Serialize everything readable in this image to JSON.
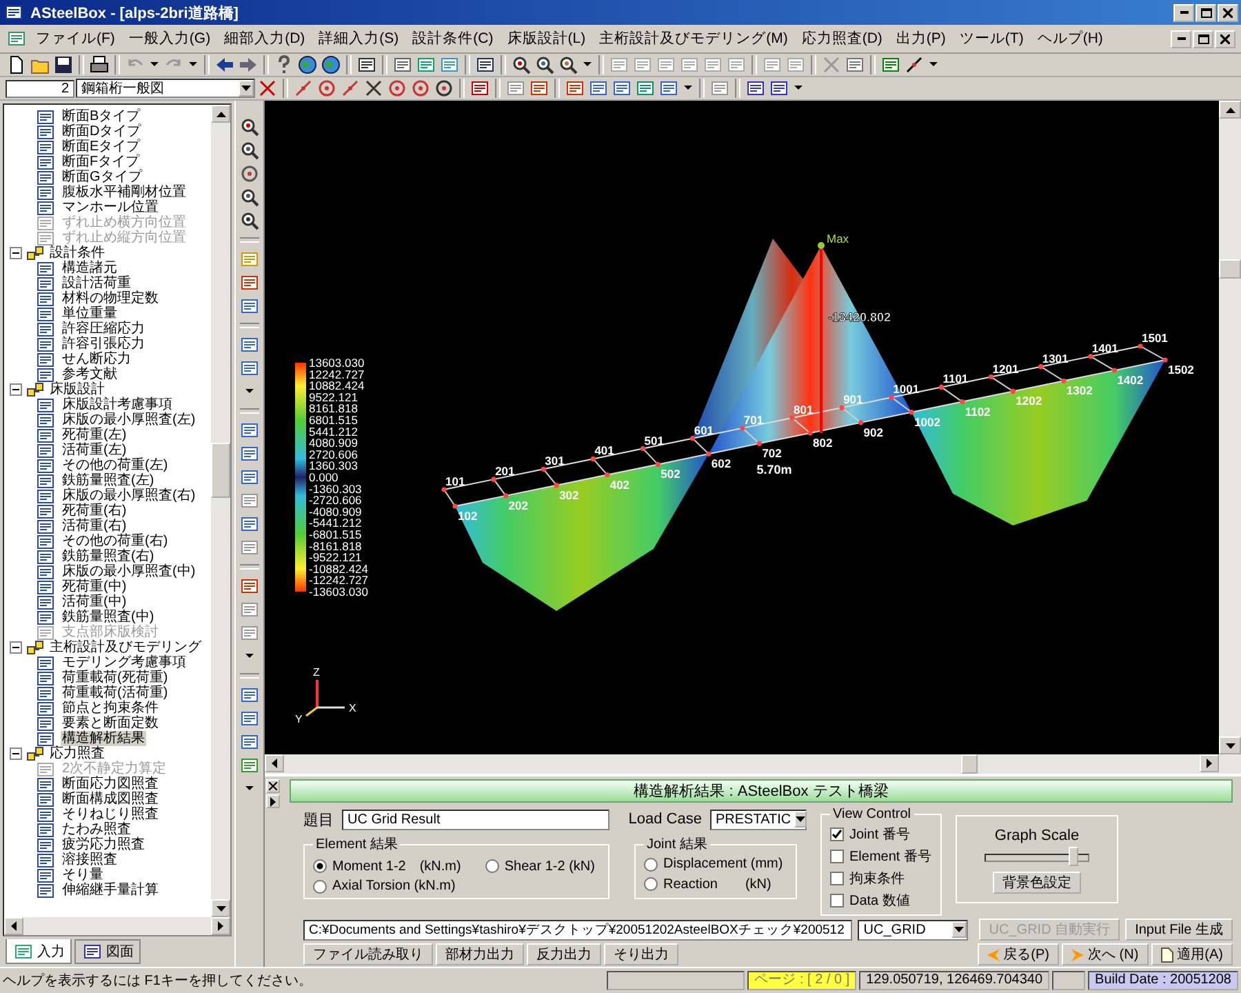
{
  "window": {
    "title": "ASteelBox - [alps-2bri道路橋]"
  },
  "menu": [
    "ファイル(F)",
    "一般入力(G)",
    "細部入力(D)",
    "詳細入力(S)",
    "設計条件(C)",
    "床版設計(L)",
    "主桁設計及びモデリング(M)",
    "応力照査(D)",
    "出力(P)",
    "ツール(T)",
    "ヘルプ(H)"
  ],
  "toolbar": {
    "page_number": "2",
    "view_select": "鋼箱桁一般図"
  },
  "tree": {
    "items": [
      {
        "label": "断面Bタイプ",
        "selected": false,
        "disabled": false
      },
      {
        "label": "断面Dタイプ",
        "selected": false,
        "disabled": false
      },
      {
        "label": "断面Eタイプ",
        "selected": false,
        "disabled": false
      },
      {
        "label": "断面Fタイプ",
        "selected": false,
        "disabled": false
      },
      {
        "label": "断面Gタイプ",
        "selected": false,
        "disabled": false
      },
      {
        "label": "腹板水平補剛材位置",
        "selected": false,
        "disabled": false
      },
      {
        "label": "マンホール位置",
        "selected": false,
        "disabled": false
      },
      {
        "label": "ずれ止め横方向位置",
        "selected": false,
        "disabled": true
      },
      {
        "label": "ずれ止め縦方向位置",
        "selected": false,
        "disabled": true
      }
    ],
    "groups": [
      {
        "label": "設計条件",
        "expanded": true,
        "children": [
          {
            "label": "構造諸元",
            "selected": false,
            "disabled": false
          },
          {
            "label": "設計活荷重",
            "selected": false,
            "disabled": false
          },
          {
            "label": "材料の物理定数",
            "selected": false,
            "disabled": false
          },
          {
            "label": "単位重量",
            "selected": false,
            "disabled": false
          },
          {
            "label": "許容圧縮応力",
            "selected": false,
            "disabled": false
          },
          {
            "label": "許容引張応力",
            "selected": false,
            "disabled": false
          },
          {
            "label": "せん断応力",
            "selected": false,
            "disabled": false
          },
          {
            "label": "参考文献",
            "selected": false,
            "disabled": false
          }
        ]
      },
      {
        "label": "床版設計",
        "expanded": true,
        "children": [
          {
            "label": "床版設計考慮事項",
            "selected": false,
            "disabled": false
          },
          {
            "label": "床版の最小厚照査(左)",
            "selected": false,
            "disabled": false
          },
          {
            "label": "死荷重(左)",
            "selected": false,
            "disabled": false
          },
          {
            "label": "活荷重(左)",
            "selected": false,
            "disabled": false
          },
          {
            "label": "その他の荷重(左)",
            "selected": false,
            "disabled": false
          },
          {
            "label": "鉄筋量照査(左)",
            "selected": false,
            "disabled": false
          },
          {
            "label": "床版の最小厚照査(右)",
            "selected": false,
            "disabled": false
          },
          {
            "label": "死荷重(右)",
            "selected": false,
            "disabled": false
          },
          {
            "label": "活荷重(右)",
            "selected": false,
            "disabled": false
          },
          {
            "label": "その他の荷重(右)",
            "selected": false,
            "disabled": false
          },
          {
            "label": "鉄筋量照査(右)",
            "selected": false,
            "disabled": false
          },
          {
            "label": "床版の最小厚照査(中)",
            "selected": false,
            "disabled": false
          },
          {
            "label": "死荷重(中)",
            "selected": false,
            "disabled": false
          },
          {
            "label": "活荷重(中)",
            "selected": false,
            "disabled": false
          },
          {
            "label": "鉄筋量照査(中)",
            "selected": false,
            "disabled": false
          },
          {
            "label": "支点部床版検討",
            "selected": false,
            "disabled": true
          }
        ]
      },
      {
        "label": "主桁設計及びモデリング",
        "expanded": true,
        "children": [
          {
            "label": "モデリング考慮事項",
            "selected": false,
            "disabled": false
          },
          {
            "label": "荷重載荷(死荷重)",
            "selected": false,
            "disabled": false
          },
          {
            "label": "荷重載荷(活荷重)",
            "selected": false,
            "disabled": false
          },
          {
            "label": "節点と拘束条件",
            "selected": false,
            "disabled": false
          },
          {
            "label": "要素と断面定数",
            "selected": false,
            "disabled": false
          },
          {
            "label": "構造解析結果",
            "selected": true,
            "disabled": false
          }
        ]
      },
      {
        "label": "応力照査",
        "expanded": true,
        "children": [
          {
            "label": "2次不静定力算定",
            "selected": false,
            "disabled": true
          },
          {
            "label": "断面応力図照査",
            "selected": false,
            "disabled": false
          },
          {
            "label": "断面構成図照査",
            "selected": false,
            "disabled": false
          },
          {
            "label": "そりねじり照査",
            "selected": false,
            "disabled": false
          },
          {
            "label": "たわみ照査",
            "selected": false,
            "disabled": false
          },
          {
            "label": "疲労応力照査",
            "selected": false,
            "disabled": false
          },
          {
            "label": "溶接照査",
            "selected": false,
            "disabled": false
          },
          {
            "label": "そり量",
            "selected": false,
            "disabled": false
          },
          {
            "label": "伸縮継手量計算",
            "selected": false,
            "disabled": false
          }
        ]
      }
    ]
  },
  "tree_tabs": [
    {
      "label": "入力",
      "selected": true
    },
    {
      "label": "図面",
      "selected": false
    }
  ],
  "viewport": {
    "legend": [
      "13603.030",
      "12242.727",
      "10882.424",
      "9522.121",
      "8161.818",
      "6801.515",
      "5441.212",
      "4080.909",
      "2720.606",
      "1360.303",
      "0.000",
      "-1360.303",
      "-2720.606",
      "-4080.909",
      "-5441.212",
      "-6801.515",
      "-8161.818",
      "-9522.121",
      "-10882.424",
      "-12242.727",
      "-13603.030"
    ],
    "joints_back": [
      "101",
      "201",
      "301",
      "401",
      "501",
      "601",
      "701",
      "801",
      "901",
      "1001",
      "1101",
      "1201",
      "1301",
      "1401",
      "1501"
    ],
    "joints_front": [
      "102",
      "202",
      "302",
      "402",
      "502",
      "602",
      "702",
      "802",
      "902",
      "1002",
      "1102",
      "1202",
      "1302",
      "1402",
      "1502"
    ],
    "max_label": "Max",
    "max_value": "-13420.802",
    "distance_label": "5.70m",
    "axes": [
      "Z",
      "X",
      "Y"
    ]
  },
  "result_panel": {
    "title": "構造解析結果 : ASteelBox テスト橋梁",
    "subject_label": "題目",
    "subject_value": "UC Grid Result",
    "load_case_label": "Load Case",
    "load_case_value": "PRESTATIC",
    "element_group": {
      "title": "Element 結果",
      "options": [
        {
          "label": "Moment 1-2　(kN.m)",
          "selected": true
        },
        {
          "label": "Shear 1-2 (kN)",
          "selected": false
        },
        {
          "label": "Axial Torsion (kN.m)",
          "selected": false
        }
      ]
    },
    "joint_group": {
      "title": "Joint 結果",
      "options": [
        {
          "label": "Displacement (mm)",
          "selected": false
        },
        {
          "label": "Reaction　　(kN)",
          "selected": false
        }
      ]
    },
    "view_control": {
      "title": "View Control",
      "options": [
        {
          "label": "Joint 番号",
          "checked": true
        },
        {
          "label": "Element 番号",
          "checked": false
        },
        {
          "label": "拘束条件",
          "checked": false
        },
        {
          "label": "Data 数値",
          "checked": false
        }
      ]
    },
    "graph_scale": {
      "title": "Graph Scale",
      "level": 0.85,
      "button": "背景色設定"
    },
    "file_path": "C:¥Documents and Settings¥tashiro¥デスクトップ¥20051202AsteelBOXチェック¥200512",
    "file_type": "UC_GRID",
    "run_button": {
      "label": "UC_GRID 自動実行",
      "disabled": true
    },
    "generate_button": {
      "label": "Input File 生成",
      "disabled": false
    },
    "output_buttons": [
      "ファイル読み取り",
      "部材力出力",
      "反力出力",
      "そり出力"
    ],
    "back_button": "戻る(P)",
    "next_button": "次へ (N)",
    "apply_button": "適用(A)"
  },
  "status_bar": {
    "help": "ヘルプを表示するには F1キーを押してください。",
    "page": "ページ : [ 2 / 0 ]",
    "coordinates": "129.050719,  126469.704340",
    "build": "Build Date : 20051208"
  }
}
